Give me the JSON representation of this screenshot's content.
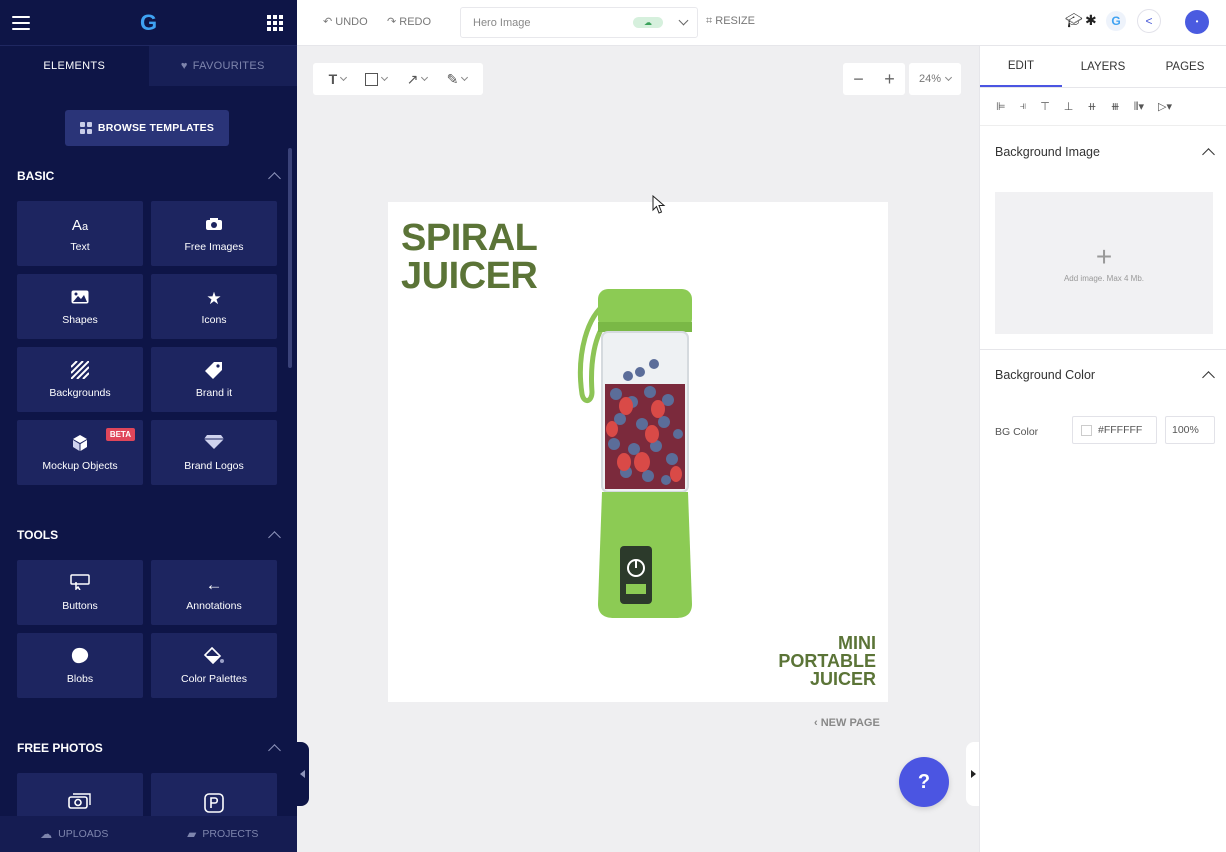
{
  "sidebar": {
    "tabs": [
      {
        "label": "ELEMENTS"
      },
      {
        "label": "FAVOURITES"
      }
    ],
    "browse_templates": "BROWSE TEMPLATES",
    "sections": [
      {
        "title": "BASIC",
        "items": [
          {
            "label": "Text",
            "icon": "text-icon"
          },
          {
            "label": "Free Images",
            "icon": "camera-icon"
          },
          {
            "label": "Shapes",
            "icon": "image-icon"
          },
          {
            "label": "Icons",
            "icon": "star-icon"
          },
          {
            "label": "Backgrounds",
            "icon": "stripes-icon"
          },
          {
            "label": "Brand it",
            "icon": "tag-icon"
          },
          {
            "label": "Mockup Objects",
            "icon": "cube-icon",
            "badge": "BETA"
          },
          {
            "label": "Brand Logos",
            "icon": "diamond-icon"
          }
        ]
      },
      {
        "title": "TOOLS",
        "items": [
          {
            "label": "Buttons",
            "icon": "cursor-button-icon"
          },
          {
            "label": "Annotations",
            "icon": "arrow-left-icon"
          },
          {
            "label": "Blobs",
            "icon": "blob-icon"
          },
          {
            "label": "Color Palettes",
            "icon": "paint-bucket-icon"
          }
        ]
      },
      {
        "title": "FREE PHOTOS",
        "items": [
          {
            "label": "",
            "icon": "photos-icon"
          },
          {
            "label": "",
            "icon": "p-logo-icon"
          }
        ]
      }
    ],
    "bottom": [
      {
        "label": "UPLOADS",
        "icon": "cloud-upload-icon"
      },
      {
        "label": "PROJECTS",
        "icon": "folder-icon"
      }
    ]
  },
  "topbar": {
    "undo": "UNDO",
    "redo": "REDO",
    "document_name": "Hero Image",
    "resize": "RESIZE"
  },
  "canvas": {
    "zoom": "24%",
    "headline_line1": "SPIRAL",
    "headline_line2": "JUICER",
    "subline_1": "MINI",
    "subline_2": "PORTABLE",
    "subline_3": "JUICER",
    "new_page": "NEW PAGE",
    "help": "?"
  },
  "right_panel": {
    "tabs": [
      {
        "label": "EDIT"
      },
      {
        "label": "LAYERS"
      },
      {
        "label": "PAGES"
      }
    ],
    "bg_image_title": "Background Image",
    "add_image_hint": "Add image. Max 4 Mb.",
    "bg_color_title": "Background Color",
    "bg_color_label": "BG Color",
    "bg_color_value": "#FFFFFF",
    "bg_opacity": "100%"
  },
  "colors": {
    "sidebar_bg": "#0e1547",
    "tile_bg": "#1d2560",
    "accent": "#4b55e2",
    "headline_green": "#5b7437",
    "beta_red": "#e0465a"
  }
}
